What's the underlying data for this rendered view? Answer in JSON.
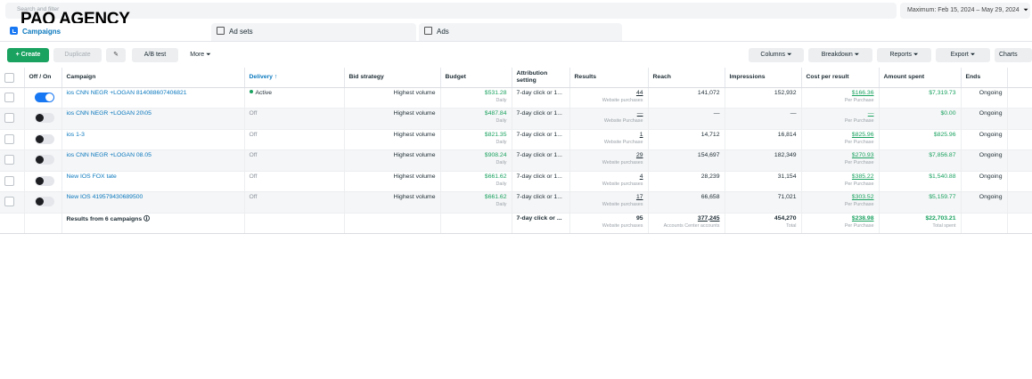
{
  "header": {
    "search_placeholder": "Search and filter",
    "agency_title": "PAQ AGENCY",
    "date_range": "Maximum: Feb 15, 2024 – May 29, 2024",
    "date_chevron": "⏷"
  },
  "tabs": [
    {
      "label": "Campaigns"
    },
    {
      "label": "Ad sets"
    },
    {
      "label": "Ads"
    }
  ],
  "toolbar": {
    "create_label": "+ Create",
    "duplicate_label": "Duplicate",
    "edit_label": "✎",
    "ab_label": "A/B test",
    "more_label": "More ⏷",
    "columns_label": "Columns ⏷",
    "breakdown_label": "Breakdown ⏷",
    "reports_label": "Reports ⏷",
    "export_label": "Export ⏷",
    "charts_label": "Charts"
  },
  "columns": {
    "onoff": "Off / On",
    "campaign": "Campaign",
    "delivery": "Delivery ↑",
    "bid": "Bid strategy",
    "budget": "Budget",
    "attribution": "Attribution setting",
    "results": "Results",
    "reach": "Reach",
    "impressions": "Impressions",
    "cpr": "Cost per result",
    "spent": "Amount spent",
    "ends": "Ends"
  },
  "rows": [
    {
      "on": true,
      "name": "ios CNN NEGR +LOGAN 814088607406821",
      "delivery": "Active",
      "bid": "Highest volume",
      "budget": "$531.28",
      "budget_sub": "Daily",
      "attribution": "7-day click or 1...",
      "results": "44",
      "results_sub": "Website purchases",
      "reach": "141,072",
      "impressions": "152,932",
      "cpr": "$166.36",
      "cpr_sub": "Per Purchase",
      "spent": "$7,319.73",
      "ends": "Ongoing"
    },
    {
      "on": false,
      "name": "ios CNN NEGR +LOGAN 20\\05",
      "delivery": "Off",
      "bid": "Highest volume",
      "budget": "$487.84",
      "budget_sub": "Daily",
      "attribution": "7-day click or 1...",
      "results": "—",
      "results_sub": "Website Purchase",
      "reach": "—",
      "impressions": "—",
      "cpr": "—",
      "cpr_sub": "Per Purchase",
      "spent": "$0.00",
      "ends": "Ongoing"
    },
    {
      "on": false,
      "name": "ios 1-3",
      "delivery": "Off",
      "bid": "Highest volume",
      "budget": "$821.35",
      "budget_sub": "Daily",
      "attribution": "7-day click or 1...",
      "results": "1",
      "results_sub": "Website Purchase",
      "reach": "14,712",
      "impressions": "16,814",
      "cpr": "$825.96",
      "cpr_sub": "Per Purchase",
      "spent": "$825.96",
      "ends": "Ongoing"
    },
    {
      "on": false,
      "name": "ios CNN NEGR +LOGAN 08.05",
      "delivery": "Off",
      "bid": "Highest volume",
      "budget": "$908.24",
      "budget_sub": "Daily",
      "attribution": "7-day click or 1...",
      "results": "29",
      "results_sub": "Website purchases",
      "reach": "154,697",
      "impressions": "182,349",
      "cpr": "$270.93",
      "cpr_sub": "Per Purchase",
      "spent": "$7,856.87",
      "ends": "Ongoing"
    },
    {
      "on": false,
      "name": "New IOS FOX tate",
      "delivery": "Off",
      "bid": "Highest volume",
      "budget": "$661.62",
      "budget_sub": "Daily",
      "attribution": "7-day click or 1...",
      "results": "4",
      "results_sub": "Website purchases",
      "reach": "28,239",
      "impressions": "31,154",
      "cpr": "$385.22",
      "cpr_sub": "Per Purchase",
      "spent": "$1,540.88",
      "ends": "Ongoing"
    },
    {
      "on": false,
      "name": "New IOS 419579430689500",
      "delivery": "Off",
      "bid": "Highest volume",
      "budget": "$661.62",
      "budget_sub": "Daily",
      "attribution": "7-day click or 1...",
      "results": "17",
      "results_sub": "Website purchases",
      "reach": "66,658",
      "impressions": "71,021",
      "cpr": "$303.52",
      "cpr_sub": "Per Purchase",
      "spent": "$5,159.77",
      "ends": "Ongoing"
    }
  ],
  "summary": {
    "label": "Results from 6 campaigns",
    "attribution": "7-day click or ...",
    "results": "95",
    "results_sub": "Website purchases",
    "reach": "377,245",
    "reach_sub": "Accounts Center accounts",
    "impressions": "454,270",
    "impressions_sub": "Total",
    "cpr": "$238.98",
    "cpr_sub": "Per Purchase",
    "spent": "$22,703.21",
    "spent_sub": "Total spent"
  },
  "colors": {
    "accent": "#1877f2",
    "link": "#0a78be",
    "money": "#1aa260"
  }
}
